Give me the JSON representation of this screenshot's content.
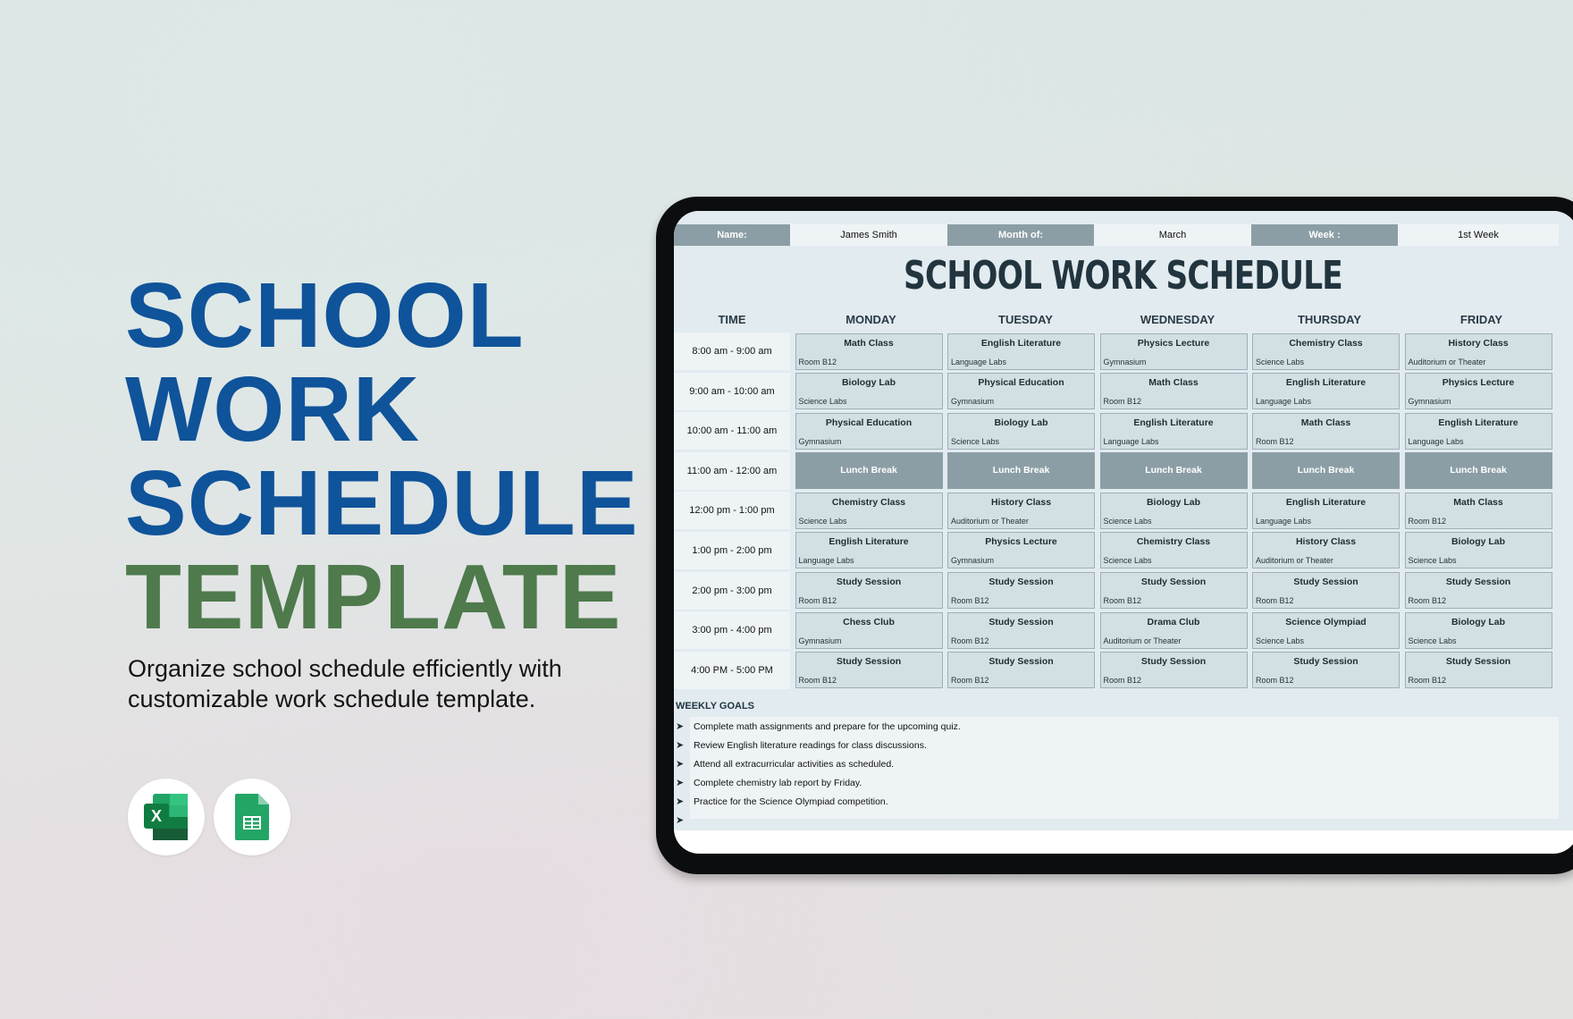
{
  "hero": {
    "lines": [
      "SCHOOL",
      "WORK",
      "SCHEDULE",
      "TEMPLATE"
    ],
    "subtitle_line1": "Organize school schedule efficiently with",
    "subtitle_line2": "customizable work schedule template.",
    "colors": {
      "primary": "#0f539a",
      "accent": "#4e7a4c"
    }
  },
  "app_icons": [
    {
      "name": "excel-icon",
      "letter": "X"
    },
    {
      "name": "google-sheets-icon"
    }
  ],
  "sheet": {
    "info": {
      "name_label": "Name:",
      "name_value": "James Smith",
      "month_label": "Month of:",
      "month_value": "March",
      "week_label": "Week :",
      "week_value": "1st Week"
    },
    "title": "SCHOOL WORK SCHEDULE",
    "columns": [
      "TIME",
      "MONDAY",
      "TUESDAY",
      "WEDNESDAY",
      "THURSDAY",
      "FRIDAY"
    ],
    "rows": [
      {
        "time": "8:00 am - 9:00 am",
        "slots": [
          {
            "subject": "Math Class",
            "room": "Room B12"
          },
          {
            "subject": "English Literature",
            "room": "Language Labs"
          },
          {
            "subject": "Physics Lecture",
            "room": "Gymnasium"
          },
          {
            "subject": "Chemistry Class",
            "room": "Science Labs"
          },
          {
            "subject": "History Class",
            "room": "Auditorium or Theater"
          }
        ]
      },
      {
        "time": "9:00 am - 10:00 am",
        "slots": [
          {
            "subject": "Biology Lab",
            "room": "Science Labs"
          },
          {
            "subject": "Physical Education",
            "room": "Gymnasium"
          },
          {
            "subject": "Math Class",
            "room": "Room B12"
          },
          {
            "subject": "English Literature",
            "room": "Language Labs"
          },
          {
            "subject": "Physics Lecture",
            "room": "Gymnasium"
          }
        ]
      },
      {
        "time": "10:00 am - 11:00 am",
        "slots": [
          {
            "subject": "Physical Education",
            "room": "Gymnasium"
          },
          {
            "subject": "Biology Lab",
            "room": "Science Labs"
          },
          {
            "subject": "English Literature",
            "room": "Language Labs"
          },
          {
            "subject": "Math Class",
            "room": "Room B12"
          },
          {
            "subject": "English Literature",
            "room": "Language Labs"
          }
        ]
      },
      {
        "time": "11:00 am - 12:00 am",
        "lunch": true,
        "slots": [
          {
            "subject": "Lunch Break",
            "room": ""
          },
          {
            "subject": "Lunch Break",
            "room": ""
          },
          {
            "subject": "Lunch Break",
            "room": ""
          },
          {
            "subject": "Lunch Break",
            "room": ""
          },
          {
            "subject": "Lunch Break",
            "room": ""
          }
        ]
      },
      {
        "time": "12:00 pm - 1:00 pm",
        "slots": [
          {
            "subject": "Chemistry Class",
            "room": "Science Labs"
          },
          {
            "subject": "History Class",
            "room": "Auditorium or Theater"
          },
          {
            "subject": "Biology Lab",
            "room": "Science Labs"
          },
          {
            "subject": "English Literature",
            "room": "Language Labs"
          },
          {
            "subject": "Math Class",
            "room": "Room B12"
          }
        ]
      },
      {
        "time": "1:00 pm - 2:00 pm",
        "slots": [
          {
            "subject": "English Literature",
            "room": "Language Labs"
          },
          {
            "subject": "Physics Lecture",
            "room": "Gymnasium"
          },
          {
            "subject": "Chemistry Class",
            "room": "Science Labs"
          },
          {
            "subject": "History Class",
            "room": "Auditorium or Theater"
          },
          {
            "subject": "Biology Lab",
            "room": "Science Labs"
          }
        ]
      },
      {
        "time": "2:00 pm - 3:00 pm",
        "slots": [
          {
            "subject": "Study Session",
            "room": "Room B12"
          },
          {
            "subject": "Study Session",
            "room": "Room B12"
          },
          {
            "subject": "Study Session",
            "room": "Room B12"
          },
          {
            "subject": "Study Session",
            "room": "Room B12"
          },
          {
            "subject": "Study Session",
            "room": "Room B12"
          }
        ]
      },
      {
        "time": "3:00 pm - 4:00 pm",
        "slots": [
          {
            "subject": "Chess Club",
            "room": "Gymnasium"
          },
          {
            "subject": "Study Session",
            "room": "Room B12"
          },
          {
            "subject": "Drama Club",
            "room": "Auditorium or Theater"
          },
          {
            "subject": "Science Olympiad",
            "room": "Science Labs"
          },
          {
            "subject": "Biology Lab",
            "room": "Science Labs"
          }
        ]
      },
      {
        "time": "4:00 PM - 5:00 PM",
        "slots": [
          {
            "subject": "Study Session",
            "room": "Room B12"
          },
          {
            "subject": "Study Session",
            "room": "Room B12"
          },
          {
            "subject": "Study Session",
            "room": "Room B12"
          },
          {
            "subject": "Study Session",
            "room": "Room B12"
          },
          {
            "subject": "Study Session",
            "room": "Room B12"
          }
        ]
      }
    ],
    "goals_label": "WEEKLY GOALS",
    "goals": [
      " Complete math assignments and prepare for the upcoming quiz.",
      "Review English literature readings for class discussions.",
      "Attend all extracurricular activities as scheduled.",
      "Complete chemistry lab report by Friday.",
      "Practice for the Science Olympiad competition.",
      ""
    ],
    "goal_bullet": "➤",
    "colors": {
      "label_bg": "#8c9ea5",
      "cell_bg": "#d2dfe3",
      "title": "#22353f"
    }
  }
}
